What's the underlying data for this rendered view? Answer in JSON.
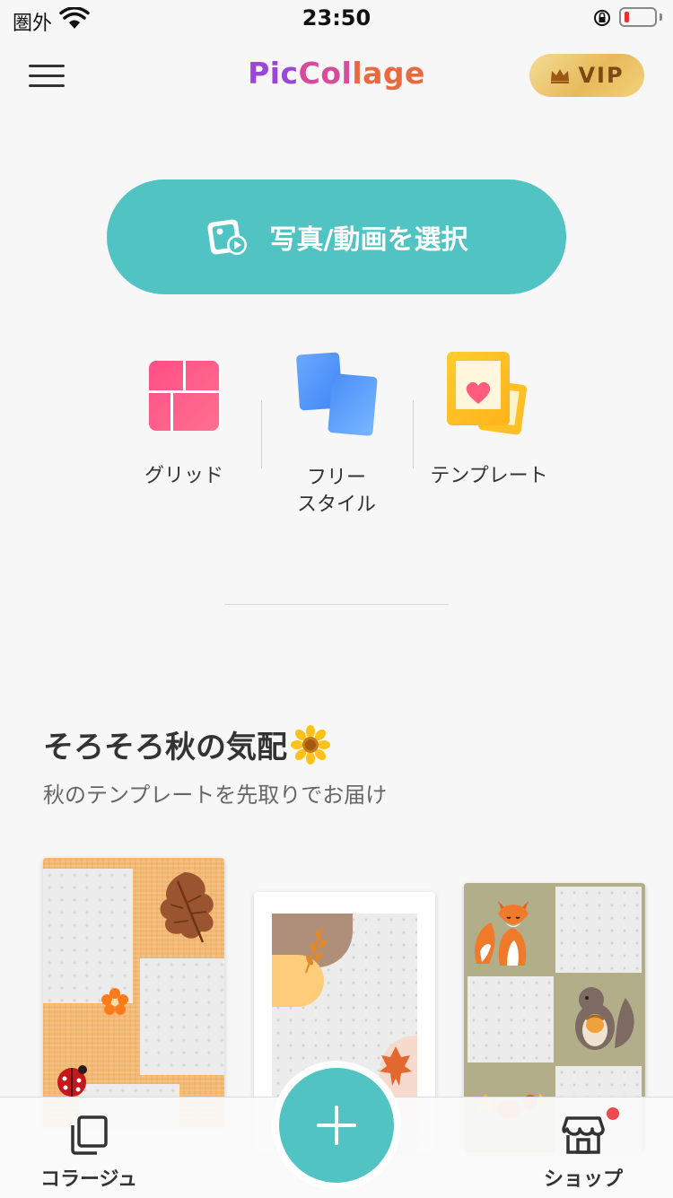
{
  "status_bar": {
    "carrier": "圏外",
    "time": "23:50"
  },
  "header": {
    "logo_part1": "Pic",
    "logo_part2": "Col",
    "logo_part3": "lage",
    "vip_label": "VIP"
  },
  "select_button": {
    "label": "写真/動画を選択"
  },
  "modes": [
    {
      "label": "グリッド"
    },
    {
      "label_line1": "フリー",
      "label_line2": "スタイル"
    },
    {
      "label": "テンプレート"
    }
  ],
  "section": {
    "title": "そろそろ秋の気配",
    "subtitle": "秋のテンプレートを先取りでお届け"
  },
  "tab_bar": {
    "collage_label": "コラージュ",
    "shop_label": "ショップ"
  },
  "colors": {
    "accent": "#52c3c3",
    "battery_low": "#e5322d",
    "notification_dot": "#f0484f"
  }
}
